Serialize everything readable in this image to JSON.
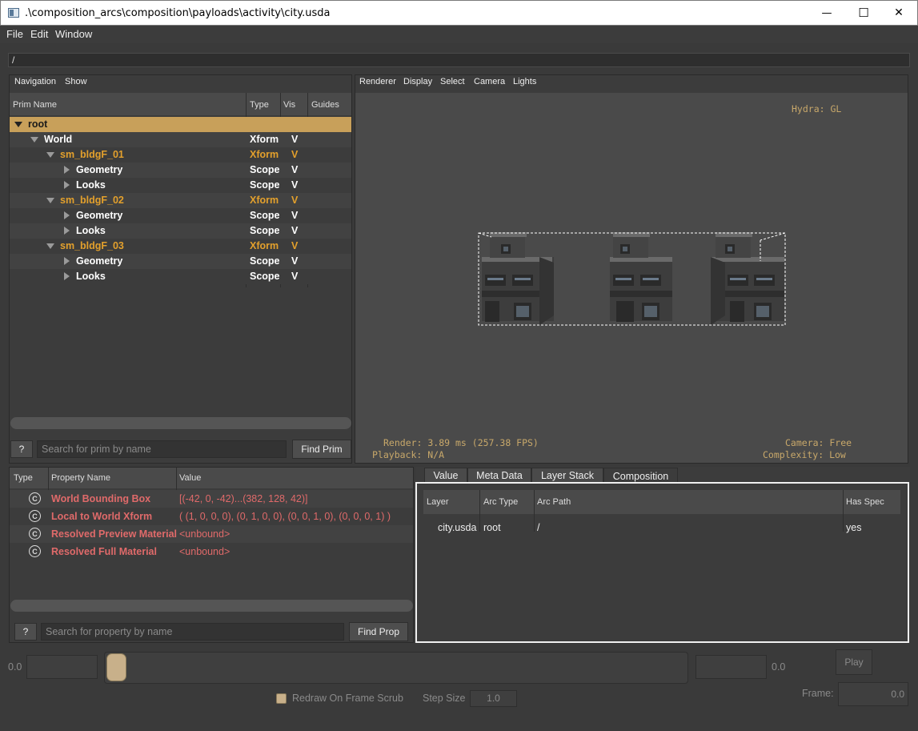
{
  "window": {
    "title": ".\\composition_arcs\\composition\\payloads\\activity\\city.usda",
    "minimize": "—",
    "maximize": "☐",
    "close": "✕"
  },
  "menubar": {
    "file": "File",
    "edit": "Edit",
    "window": "Window"
  },
  "path": "/",
  "prim_panel": {
    "menu": {
      "navigation": "Navigation",
      "show": "Show"
    },
    "columns": {
      "name": "Prim Name",
      "type": "Type",
      "vis": "Vis",
      "guides": "Guides"
    },
    "rows": [
      {
        "name": "root",
        "type": "",
        "vis": "",
        "depth": 0,
        "expanded": true,
        "selected": true,
        "color": "#ffffff"
      },
      {
        "name": "World",
        "type": "Xform",
        "vis": "V",
        "depth": 1,
        "expanded": true,
        "color": "#ffffff"
      },
      {
        "name": "sm_bldgF_01",
        "type": "Xform",
        "vis": "V",
        "depth": 2,
        "expanded": true,
        "color": "#e3a02c"
      },
      {
        "name": "Geometry",
        "type": "Scope",
        "vis": "V",
        "depth": 3,
        "expanded": false,
        "color": "#ffffff"
      },
      {
        "name": "Looks",
        "type": "Scope",
        "vis": "V",
        "depth": 3,
        "expanded": false,
        "color": "#ffffff"
      },
      {
        "name": "sm_bldgF_02",
        "type": "Xform",
        "vis": "V",
        "depth": 2,
        "expanded": true,
        "color": "#e3a02c"
      },
      {
        "name": "Geometry",
        "type": "Scope",
        "vis": "V",
        "depth": 3,
        "expanded": false,
        "color": "#ffffff"
      },
      {
        "name": "Looks",
        "type": "Scope",
        "vis": "V",
        "depth": 3,
        "expanded": false,
        "color": "#ffffff"
      },
      {
        "name": "sm_bldgF_03",
        "type": "Xform",
        "vis": "V",
        "depth": 2,
        "expanded": true,
        "color": "#e3a02c"
      },
      {
        "name": "Geometry",
        "type": "Scope",
        "vis": "V",
        "depth": 3,
        "expanded": false,
        "color": "#ffffff"
      },
      {
        "name": "Looks",
        "type": "Scope",
        "vis": "V",
        "depth": 3,
        "expanded": false,
        "color": "#ffffff"
      }
    ],
    "help_label": "?",
    "search_placeholder": "Search for prim by name",
    "find_label": "Find Prim"
  },
  "viewport": {
    "menu": {
      "renderer": "Renderer",
      "display": "Display",
      "select": "Select",
      "camera": "Camera",
      "lights": "Lights"
    },
    "hud_renderer": "Hydra: GL",
    "hud_render": "Render: 3.89 ms (257.38 FPS)",
    "hud_playback": "Playback: N/A",
    "hud_camera": "Camera: Free",
    "hud_complexity": "Complexity: Low"
  },
  "property_panel": {
    "columns": {
      "type": "Type",
      "name": "Property Name",
      "value": "Value"
    },
    "rows": [
      {
        "icon": "C",
        "name": "World Bounding Box",
        "value": "[(-42, 0, -42)...(382, 128, 42)]"
      },
      {
        "icon": "C",
        "name": "Local to World Xform",
        "value": "( (1, 0, 0, 0), (0, 1, 0, 0), (0, 0, 1, 0), (0, 0, 0, 1) )"
      },
      {
        "icon": "C",
        "name": "Resolved Preview Material",
        "value": "<unbound>"
      },
      {
        "icon": "C",
        "name": "Resolved Full Material",
        "value": "<unbound>"
      }
    ],
    "help_label": "?",
    "search_placeholder": "Search for property by name",
    "find_label": "Find Prop"
  },
  "composition_panel": {
    "tabs": [
      "Value",
      "Meta Data",
      "Layer Stack",
      "Composition"
    ],
    "active_tab": "Composition",
    "columns": {
      "layer": "Layer",
      "arc_type": "Arc Type",
      "arc_path": "Arc Path",
      "has_spec": "Has Spec"
    },
    "rows": [
      {
        "layer": "city.usda",
        "arc_type": "root",
        "arc_path": "/",
        "has_spec": "yes"
      }
    ]
  },
  "timeline": {
    "start_value": "0.0",
    "end_value": "0.0",
    "play_label": "Play",
    "frame_label": "Frame:",
    "frame_value": "0.0",
    "redraw_label": "Redraw On Frame Scrub",
    "step_label": "Step Size",
    "step_value": "1.0"
  },
  "colors": {
    "accent": "#c8a86a",
    "selection": "#c8a05a",
    "prim_payload": "#e3a02c",
    "property": "#e06a6a"
  }
}
